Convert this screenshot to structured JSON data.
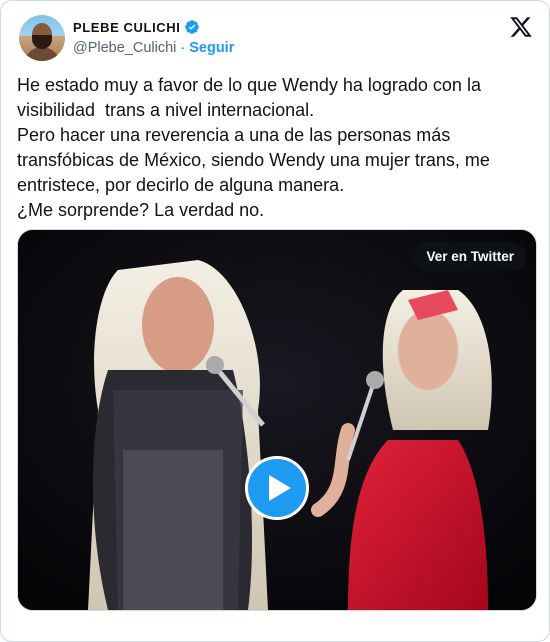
{
  "account": {
    "display_name": "PLEBE CULICHI",
    "handle": "@Plebe_Culichi",
    "separator": "·",
    "follow_label": "Seguir",
    "verified": true
  },
  "tweet": {
    "lines": [
      "He estado muy a favor de lo que Wendy ha logrado con la",
      "visibilidad  trans a nivel internacional.",
      "Pero hacer una reverencia a una de las personas más",
      "transfóbicas de México, siendo Wendy una mujer trans, me",
      "entristece, por decirlo de alguna manera.",
      "¿Me sorprende? La verdad no."
    ]
  },
  "media": {
    "view_on_twitter_label": "Ver en Twitter",
    "type": "video"
  },
  "colors": {
    "accent": "#1d9bf0",
    "text": "#0f1419",
    "secondary": "#536471",
    "border": "#cfd9de"
  }
}
